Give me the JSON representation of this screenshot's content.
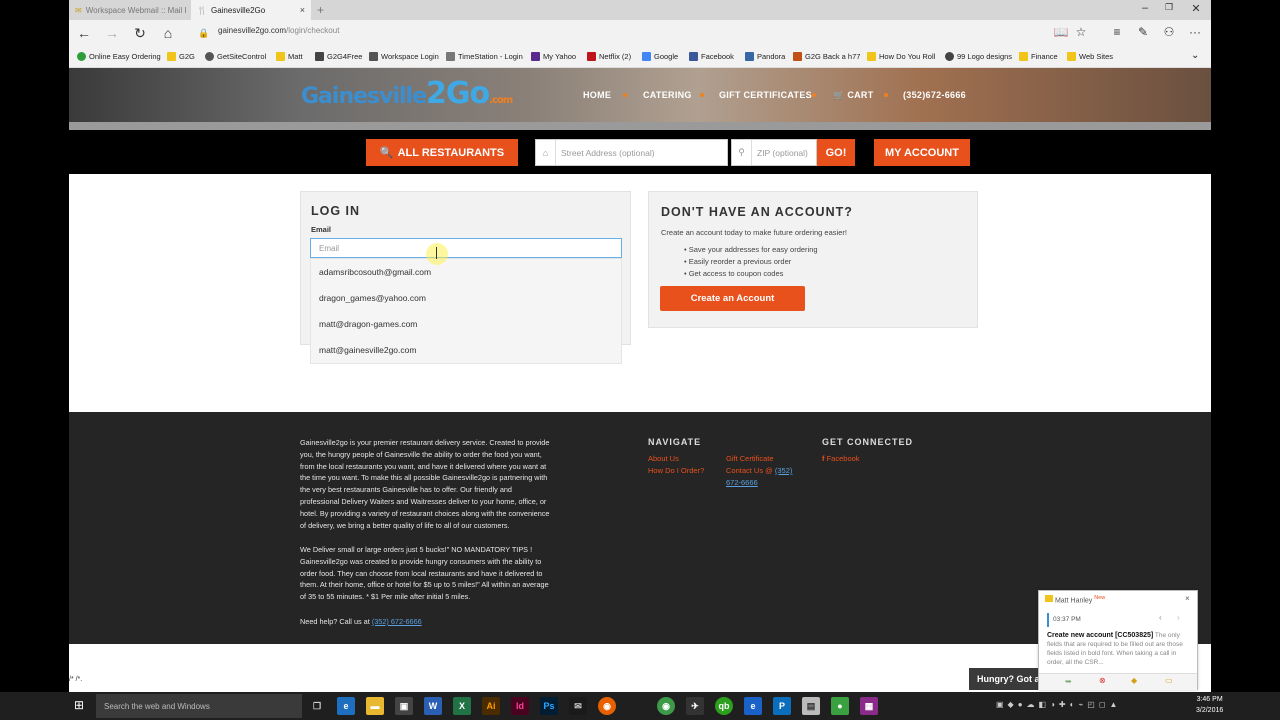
{
  "browser": {
    "tabs": [
      {
        "label": "Workspace Webmail :: Mail I",
        "close": "×"
      },
      {
        "label": "Gainesville2Go",
        "close": "×"
      }
    ],
    "new_tab": "+",
    "window_controls": {
      "minimize": "–",
      "restore": "❐",
      "close": "✕"
    },
    "url_host": "gainesville2go.com",
    "url_path": "/login/checkout",
    "favorites": [
      {
        "label": "Online Easy Ordering",
        "color": "#2e9e3a"
      },
      {
        "label": "G2G",
        "color": "#f0c419"
      },
      {
        "label": "GetSiteControl",
        "color": "#555555"
      },
      {
        "label": "Matt",
        "color": "#f0c419"
      },
      {
        "label": "G2G4Free",
        "color": "#444444"
      },
      {
        "label": "Workspace Login",
        "color": "#555555"
      },
      {
        "label": "TimeStation - Login",
        "color": "#777777"
      },
      {
        "label": "My Yahoo",
        "color": "#5b2a8f"
      },
      {
        "label": "Netflix (2)",
        "color": "#c0141c"
      },
      {
        "label": "Google",
        "color": "#4285f4"
      },
      {
        "label": "Facebook",
        "color": "#3b5998"
      },
      {
        "label": "Pandora",
        "color": "#3668a8"
      },
      {
        "label": "G2G Back a h77",
        "color": "#c05018"
      },
      {
        "label": "How Do You Roll",
        "color": "#f0c419"
      },
      {
        "label": "99 Logo designs",
        "color": "#444444"
      },
      {
        "label": "Finance",
        "color": "#f0c419"
      },
      {
        "label": "Web Sites",
        "color": "#f0c419"
      }
    ]
  },
  "site": {
    "logo": {
      "part1": "Gainesville",
      "part2": "2Go",
      "part3": ".com"
    },
    "menu": [
      "HOME",
      "CATERING",
      "GIFT CERTIFICATES",
      "CART",
      "(352)672-6666"
    ],
    "search": {
      "all_restaurants": "ALL RESTAURANTS",
      "street_placeholder": "Street Address (optional)",
      "zip_placeholder": "ZIP (optional)",
      "go": "GO!",
      "my_account": "MY ACCOUNT"
    },
    "login": {
      "title": "LOG IN",
      "email_label": "Email",
      "email_placeholder": "Email",
      "suggestions": [
        "adamsribcosouth@gmail.com",
        "dragon_games@yahoo.com",
        "matt@dragon-games.com",
        "matt@gainesville2go.com"
      ]
    },
    "signup": {
      "title": "DON'T HAVE AN ACCOUNT?",
      "subtitle": "Create an account today to make future ordering easier!",
      "bullets": [
        "Save your addresses for easy ordering",
        "Easily reorder a previous order",
        "Get access to coupon codes"
      ],
      "button": "Create an Account"
    },
    "footer": {
      "about_lines": [
        "Gainesville2go is your premier restaurant delivery service. Created to provide",
        "you, the hungry people of Gainesville the ability to order the food you want,",
        "from the local restaurants you want, and have it delivered where you want at",
        "the time you want. To make this all possible Gainesville2go is partnering with",
        "the very best restaurants Gainesville has to offer. Our friendly and",
        "professional Delivery Waiters and Waitresses deliver to your home, office, or",
        "hotel. By providing a variety of restaurant choices along with the convenience",
        "of delivery, we bring a better quality of life to all of our customers."
      ],
      "deliver_lines": [
        "We Deliver small or large orders just 5 bucks!\" NO MANDATORY TIPS !",
        "Gainesville2go was created to provide hungry consumers with the ability to",
        "order food. They can choose from local restaurants and have it delivered to",
        "them. At their home, office or hotel for $5 up to 5 miles!\" All within an average",
        "of 35 to 55 minutes. * $1 Per mile after initial 5 miles."
      ],
      "help_prefix": "Need help? Call us at",
      "help_phone": "(352) 672-6666",
      "navigate_title": "NAVIGATE",
      "nav_links": [
        "About Us",
        "How Do I Order?"
      ],
      "nav_links2": [
        "Gift Certificate",
        "Contact Us @"
      ],
      "contact_phone_a": "(352)",
      "contact_phone_b": "672-6666",
      "connect_title": "GET CONNECTED",
      "facebook": "Facebook"
    },
    "bottom_text": "/* /*."
  },
  "notification": {
    "name": "Matt Hanley",
    "badge": "New",
    "time": "03:37 PM",
    "title": "Create new account [CC503825]",
    "body1": "The only fields that are required to be filled out are those fields listed in bold font.",
    "body2": "When taking a call in order, all the CSR..."
  },
  "chat_tab": "Hungry? Got a",
  "taskbar": {
    "search_placeholder": "Search the web and Windows",
    "time": "3:46 PM",
    "date": "3/2/2016"
  },
  "colors": {
    "accent": "#e8501c",
    "footer_bg": "#252525",
    "link_blue": "#5aa0e0"
  }
}
